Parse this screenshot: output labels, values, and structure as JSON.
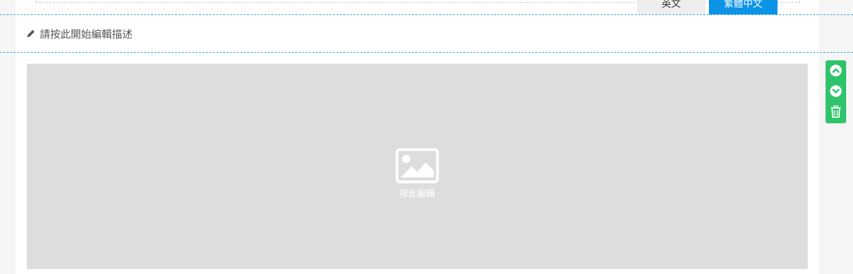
{
  "language_tabs": {
    "english": "英文",
    "traditional_chinese": "繁體中文",
    "active": "traditional_chinese"
  },
  "description": {
    "placeholder_text": "請按此開始編輯描述",
    "icon": "pencil-icon"
  },
  "image_block": {
    "edit_label": "按此編輯",
    "icon": "image-icon"
  },
  "block_toolbar": {
    "icons": [
      "chevron-up-circle-icon",
      "chevron-down-circle-icon",
      "trash-icon"
    ]
  },
  "colors": {
    "accent": "#0b93e6",
    "toolbar": "#2fc46a",
    "placeholder_bg": "#dddddd",
    "guide_line": "#3aa0d8"
  }
}
